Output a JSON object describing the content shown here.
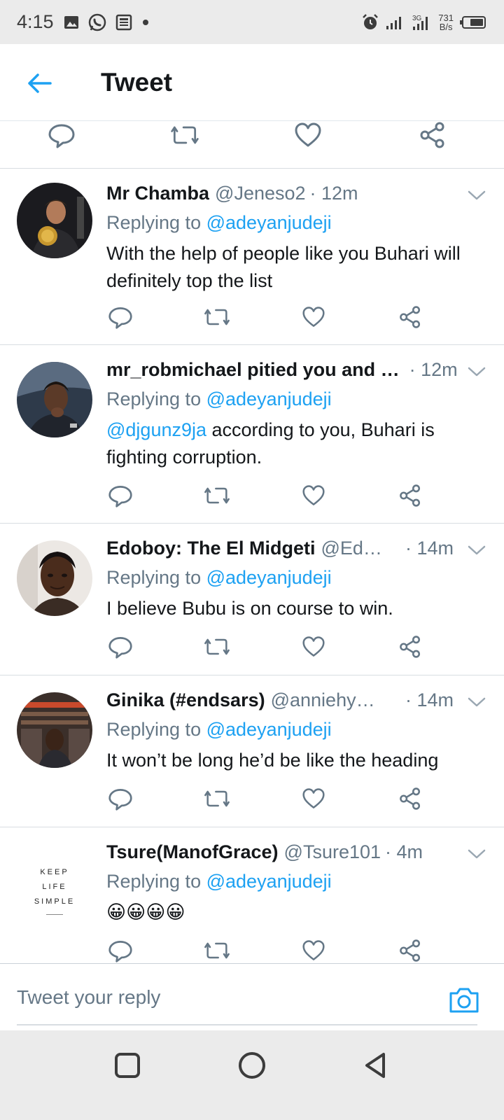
{
  "status_bar": {
    "time": "4:15",
    "net_speed_value": "731",
    "net_speed_unit": "B/s",
    "network_type": "3G"
  },
  "header": {
    "title": "Tweet"
  },
  "tweets": [
    {
      "name": "Mr Chamba",
      "handle": "@Jeneso2",
      "time": "· 12m",
      "replying_prefix": "Replying to",
      "replying_to": "@adeyanjudeji",
      "text_mention": "",
      "text": "With the help of people like you Buhari will definitely top the list"
    },
    {
      "name": "mr_robmichael pitied you and …",
      "handle": "",
      "time": "· 12m",
      "replying_prefix": "Replying to",
      "replying_to": "@adeyanjudeji",
      "text_mention": "@djgunz9ja",
      "text": " according to you, Buhari is fighting corruption."
    },
    {
      "name": "Edoboy: The El Midgeti",
      "handle": "@Ed…",
      "time": "· 14m",
      "replying_prefix": "Replying to",
      "replying_to": "@adeyanjudeji",
      "text_mention": "",
      "text": "I believe Bubu is on course to win."
    },
    {
      "name": "Ginika (#endsars)",
      "handle": "@anniehy…",
      "time": "· 14m",
      "replying_prefix": "Replying to",
      "replying_to": "@adeyanjudeji",
      "text_mention": "",
      "text": "It won’t be long he’d be like the heading"
    },
    {
      "name": "Tsure(ManofGrace)",
      "handle": "@Tsure101",
      "time": "· 4m",
      "replying_prefix": "Replying to",
      "replying_to": "@adeyanjudeji",
      "text_mention": "",
      "text": "😀😀😀😀"
    }
  ],
  "avatar_5_text": [
    "KEEP",
    "LIFE",
    "SIMPLE"
  ],
  "reply_bar": {
    "placeholder": "Tweet your reply"
  },
  "colors": {
    "accent": "#1da1f2",
    "secondary_text": "#657786",
    "primary_text": "#14171a",
    "divider": "#d8dde1",
    "system_bar": "#ebebeb"
  },
  "icons": {
    "back": "arrow-left-icon",
    "reply": "comment-bubble-icon",
    "retweet": "retweet-icon",
    "like": "heart-icon",
    "share": "share-icon",
    "caret": "chevron-down-icon",
    "camera": "camera-icon"
  }
}
